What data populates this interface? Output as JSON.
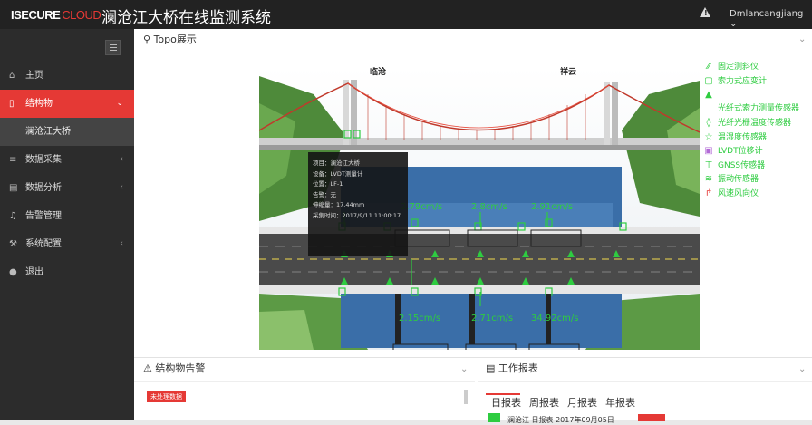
{
  "header": {
    "logo_a": "ISECURE",
    "logo_b": "CLOUD",
    "title": "澜沧江大桥在线监测系统",
    "user": "Dmlancangjiang"
  },
  "sidebar": {
    "items": [
      {
        "label": "主页",
        "icon": "home-icon",
        "glyph": "⌂",
        "chevron": ""
      },
      {
        "label": "结构物",
        "icon": "file-icon",
        "glyph": "▯",
        "chevron": "⌄",
        "active": true
      },
      {
        "label": "澜沧江大桥",
        "icon": "",
        "glyph": "",
        "chevron": "",
        "sub": true
      },
      {
        "label": "数据采集",
        "icon": "list-icon",
        "glyph": "≡",
        "chevron": "‹"
      },
      {
        "label": "数据分析",
        "icon": "chart-icon",
        "glyph": "▤",
        "chevron": "‹"
      },
      {
        "label": "告警管理",
        "icon": "bell-icon",
        "glyph": "♫",
        "chevron": ""
      },
      {
        "label": "系统配置",
        "icon": "wrench-icon",
        "glyph": "⚒",
        "chevron": "‹"
      },
      {
        "label": "退出",
        "icon": "user-icon",
        "glyph": "●",
        "chevron": ""
      }
    ]
  },
  "topo": {
    "title": "Topo展示",
    "label_left": "临沧",
    "label_right": "祥云",
    "speeds": [
      "2.79cm/s",
      "2.8cm/s",
      "2.91cm/s",
      "2.15cm/s",
      "2.71cm/s",
      "34.92cm/s"
    ],
    "tooltip": [
      "项目：澜沧江大桥",
      "设备：LVDT测量计",
      "位置：LF-1",
      "告警：无",
      "伸缩量：17.44mm",
      "采集时间：2017/9/11 11:00:17"
    ]
  },
  "legend": [
    {
      "label": "固定测斜仪",
      "icon": "inclinometer-icon",
      "glyph": "⁄⁄"
    },
    {
      "label": "索力式应变计",
      "icon": "strain-gauge-icon",
      "glyph": "▢"
    },
    {
      "label": "",
      "icon": "triangle-icon",
      "glyph": "▲"
    },
    {
      "label": "光纤式索力测量传感器",
      "icon": "fiber-sensor-icon",
      "glyph": ""
    },
    {
      "label": "光纤光栅温度传感器",
      "icon": "temperature-sensor-icon",
      "glyph": "◊"
    },
    {
      "label": "温湿度传感器",
      "icon": "humidity-sensor-icon",
      "glyph": "☆"
    },
    {
      "label": "LVDT位移计",
      "icon": "lvdt-icon",
      "glyph": "▣"
    },
    {
      "label": "GNSS传感器",
      "icon": "gnss-icon",
      "glyph": "⊤"
    },
    {
      "label": "振动传感器",
      "icon": "vibration-sensor-icon",
      "glyph": "≋"
    },
    {
      "label": "风速风向仪",
      "icon": "anemometer-icon",
      "glyph": "↱"
    }
  ],
  "alarm_panel": {
    "title": "结构物告警",
    "badge": "未处理数据"
  },
  "report_panel": {
    "title": "工作报表",
    "tabs": [
      "日报表",
      "周报表",
      "月报表",
      "年报表"
    ],
    "row_text": "澜沧江 日报表 2017年09月05日"
  }
}
